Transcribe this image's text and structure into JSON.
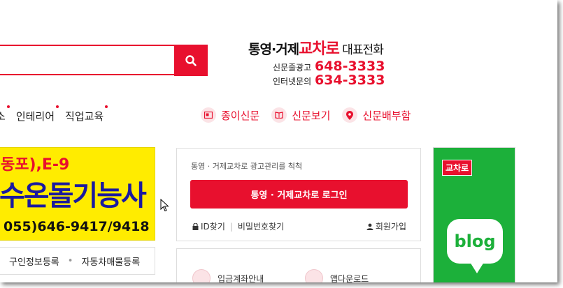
{
  "header": {
    "phone_title_pre": "통영·거제",
    "phone_title_brand": "교차로",
    "phone_title_post": " 대표전화",
    "rows": [
      {
        "label": "신문줄광고",
        "number": "648-3333"
      },
      {
        "label": "인터넷문의",
        "number": "634-3333"
      }
    ]
  },
  "search": {
    "placeholder": "",
    "icon": "search-icon"
  },
  "nav": {
    "items": [
      {
        "label": "소"
      },
      {
        "label": "인테리어"
      },
      {
        "label": "직업교육"
      }
    ]
  },
  "quick_links": [
    {
      "label": "종이신문",
      "icon": "newspaper-icon"
    },
    {
      "label": "신문보기",
      "icon": "book-icon"
    },
    {
      "label": "신문배부함",
      "icon": "location-pin-icon"
    }
  ],
  "banner": {
    "line1": "동포),E-9",
    "line2": "수온돌기능사",
    "line3": "055)646-9417/9418"
  },
  "banner_links": [
    "구인정보등록",
    "자동차매물등록"
  ],
  "login": {
    "title": "통영 · 거제교차로 광고관리를 척척",
    "button": "통영 · 거제교차로 로그인",
    "find_id": "ID찾기",
    "find_pw": "비밀번호찾기",
    "join": "회원가입"
  },
  "bottom": [
    {
      "label": "입금계좌안내",
      "icon": "bank-card-icon"
    },
    {
      "label": "앱다운로드",
      "icon": "phone-icon"
    }
  ],
  "side_banner": {
    "brand": "교차로",
    "blog": "blog"
  },
  "colors": {
    "accent": "#e8102e",
    "green": "#1cb03a",
    "banner_yellow": "#ffec00"
  }
}
